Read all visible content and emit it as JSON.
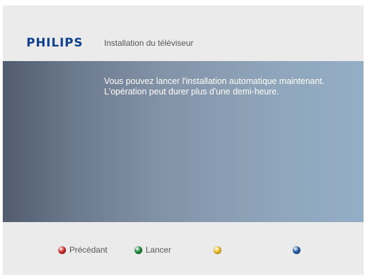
{
  "header": {
    "brand": "PHILIPS",
    "title": "Installation du téléviseur"
  },
  "panel": {
    "message_lines": [
      "Vous pouvez lancer l'installation automatique maintenant.",
      "L'opération peut durer plus d'une demi-heure."
    ]
  },
  "footer": {
    "keys": [
      {
        "color_name": "red",
        "color": "#d42a2a",
        "label": "Précédant"
      },
      {
        "color_name": "green",
        "color": "#1c8c3c",
        "label": "Lancer"
      },
      {
        "color_name": "yellow",
        "color": "#f0c21c",
        "label": ""
      },
      {
        "color_name": "blue",
        "color": "#1f5fa8",
        "label": ""
      }
    ]
  },
  "colors": {
    "brand": "#0b3f91",
    "background": "#ebebeb",
    "panel_left": "#515c6e",
    "panel_right": "#93aec5",
    "text": "#555555",
    "message_text": "#ffffff"
  }
}
